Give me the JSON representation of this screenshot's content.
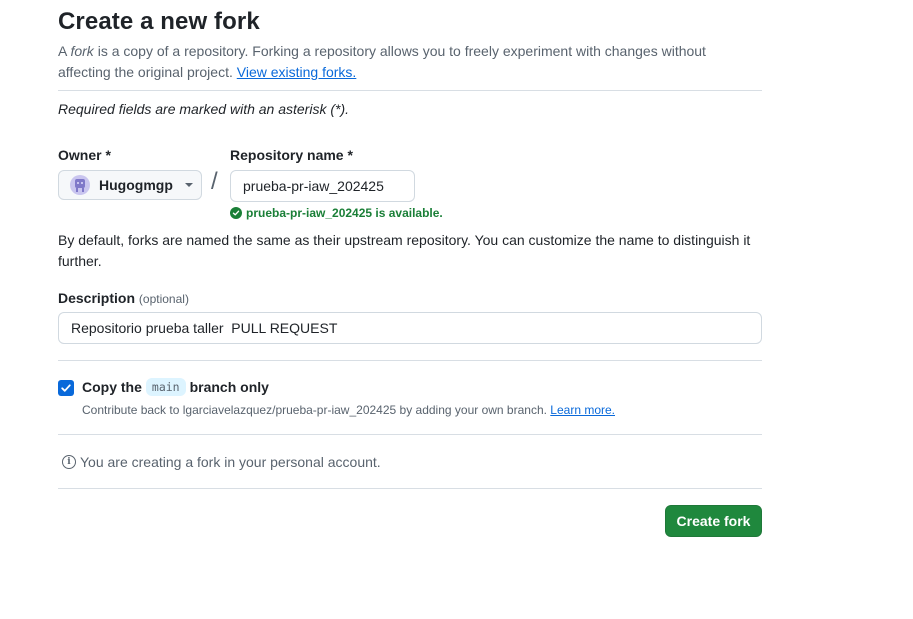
{
  "title": "Create a new fork",
  "intro": {
    "prefix": "A ",
    "fork_word": "fork",
    "text": " is a copy of a repository. Forking a repository allows you to freely experiment with changes without affecting the original project. ",
    "link": "View existing forks."
  },
  "required_note": "Required fields are marked with an asterisk (*).",
  "owner": {
    "label": "Owner *",
    "value": "Hugogmgp",
    "avatar_icon": "identicon-avatar"
  },
  "separator": "/",
  "repo": {
    "label": "Repository name *",
    "value": "prueba-pr-iaw_202425",
    "availability": "prueba-pr-iaw_202425 is available."
  },
  "naming_note": "By default, forks are named the same as their upstream repository. You can customize the name to distinguish it further.",
  "description": {
    "label": "Description",
    "optional": "(optional)",
    "value": "Repositorio prueba taller  PULL REQUEST"
  },
  "copy_branch": {
    "checked": true,
    "label_before": "Copy the",
    "branch": "main",
    "label_after": "branch only",
    "sub_text": "Contribute back to lgarciavelazquez/prueba-pr-iaw_202425 by adding your own branch. ",
    "learn_more": "Learn more."
  },
  "info_text": "You are creating a fork in your personal account.",
  "submit_label": "Create fork",
  "colors": {
    "accent": "#0969da",
    "success": "#1a7f37",
    "button_green": "#1f883d"
  }
}
